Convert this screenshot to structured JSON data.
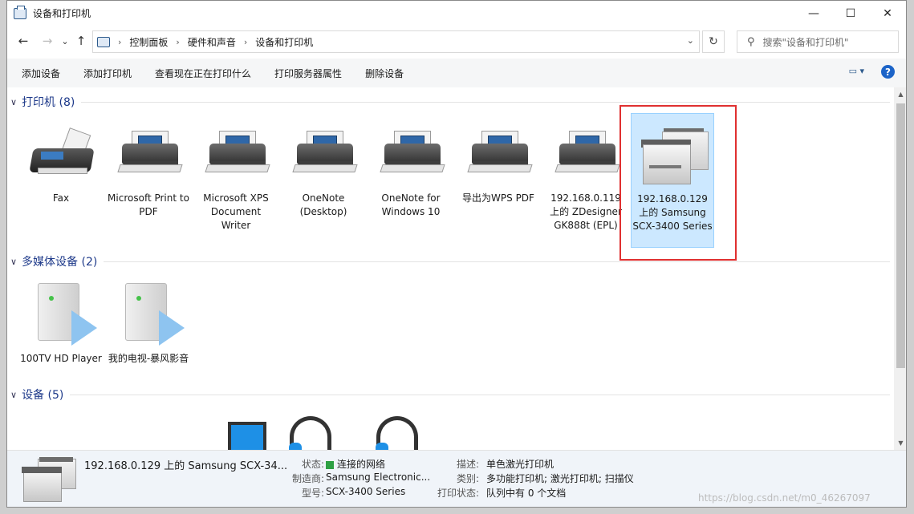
{
  "window": {
    "title": "设备和打印机"
  },
  "nav": {
    "breadcrumb": [
      "控制面板",
      "硬件和声音",
      "设备和打印机"
    ],
    "search_placeholder": "搜索\"设备和打印机\""
  },
  "toolbar": [
    "添加设备",
    "添加打印机",
    "查看现在正在打印什么",
    "打印服务器属性",
    "删除设备"
  ],
  "groups": {
    "printers": {
      "title": "打印机 (8)",
      "items": [
        {
          "label": "Fax",
          "icon": "fax-icon"
        },
        {
          "label": "Microsoft Print to PDF",
          "icon": "printer-icon"
        },
        {
          "label": "Microsoft XPS Document Writer",
          "icon": "printer-icon"
        },
        {
          "label": "OneNote (Desktop)",
          "icon": "printer-icon"
        },
        {
          "label": "OneNote for Windows 10",
          "icon": "printer-icon"
        },
        {
          "label": "导出为WPS PDF",
          "icon": "printer-icon"
        },
        {
          "label": "192.168.0.119 上的 ZDesigner GK888t (EPL)",
          "icon": "printer-icon"
        },
        {
          "label": "192.168.0.129 上的 Samsung SCX-3400 Series",
          "icon": "multifunction-printer-icon",
          "selected": true
        }
      ]
    },
    "media": {
      "title": "多媒体设备 (2)",
      "items": [
        {
          "label": "100TV HD Player",
          "icon": "media-server-icon"
        },
        {
          "label": "我的电视-暴风影音",
          "icon": "media-server-icon"
        }
      ]
    },
    "devices": {
      "title": "设备 (5)"
    }
  },
  "details": {
    "name": "192.168.0.129 上的 Samsung SCX-34...",
    "status_label": "状态:",
    "status_value": "连接的网络",
    "maker_label": "制造商:",
    "maker_value": "Samsung Electronic...",
    "model_label": "型号:",
    "model_value": "SCX-3400 Series",
    "desc_label": "描述:",
    "desc_value": "单色激光打印机",
    "category_label": "类别:",
    "category_value": "多功能打印机; 激光打印机; 扫描仪",
    "print_status_label": "打印状态:",
    "print_status_value": "队列中有 0 个文档"
  },
  "watermark": "https://blog.csdn.net/m0_46267097",
  "colors": {
    "selection": "#cce8ff",
    "highlight_box": "#e03030",
    "group_title": "#1e3a8a"
  }
}
